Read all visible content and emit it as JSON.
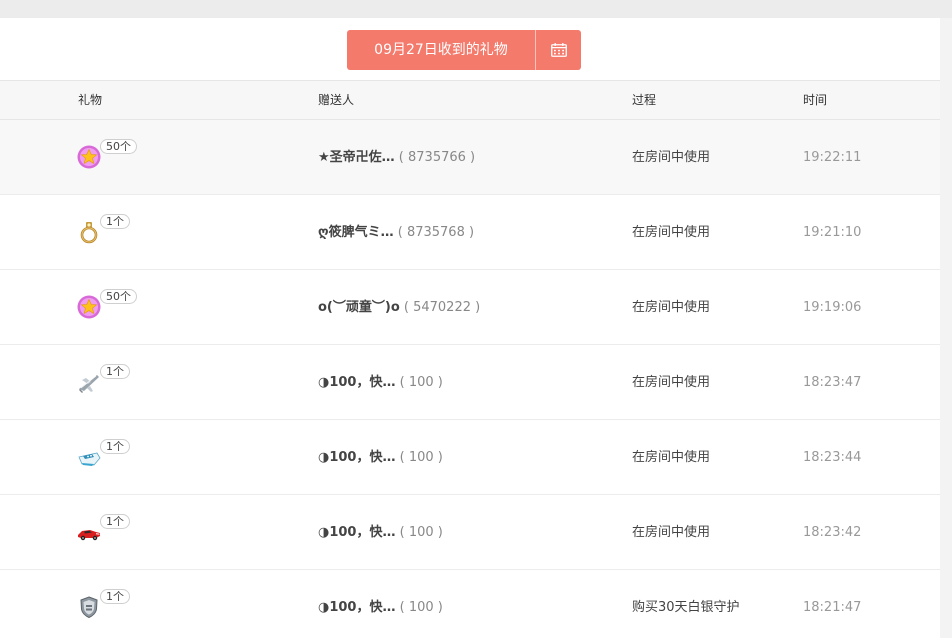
{
  "header": {
    "date_label": "09月27日收到的礼物",
    "calendar_icon": "calendar-icon"
  },
  "table": {
    "columns": [
      "礼物",
      "赠送人",
      "过程",
      "时间"
    ],
    "rows": [
      {
        "gift_icon": "star-orb-icon",
        "count": "50个",
        "nick": "★圣帝卍佐…",
        "uid": "( 8735766 )",
        "process": "在房间中使用",
        "time": "19:22:11"
      },
      {
        "gift_icon": "ring-icon",
        "count": "1个",
        "nick": "ღ筱脾气ミ…",
        "uid": "( 8735768 )",
        "process": "在房间中使用",
        "time": "19:21:10"
      },
      {
        "gift_icon": "star-orb-icon",
        "count": "50个",
        "nick": "o(︶顽童︶)o",
        "uid": "( 5470222 )",
        "process": "在房间中使用",
        "time": "19:19:06"
      },
      {
        "gift_icon": "airplane-icon",
        "count": "1个",
        "nick": "◑100，快…",
        "uid": "( 100 )",
        "process": "在房间中使用",
        "time": "18:23:47"
      },
      {
        "gift_icon": "yacht-icon",
        "count": "1个",
        "nick": "◑100，快…",
        "uid": "( 100 )",
        "process": "在房间中使用",
        "time": "18:23:44"
      },
      {
        "gift_icon": "sports-car-icon",
        "count": "1个",
        "nick": "◑100，快…",
        "uid": "( 100 )",
        "process": "在房间中使用",
        "time": "18:23:42"
      },
      {
        "gift_icon": "shield-badge-icon",
        "count": "1个",
        "nick": "◑100，快…",
        "uid": "( 100 )",
        "process": "购买30天白银守护",
        "time": "18:21:47"
      }
    ]
  },
  "colors": {
    "accent": "#f47a6c",
    "header_bg": "#f7f7f7",
    "time_text": "#999999"
  }
}
